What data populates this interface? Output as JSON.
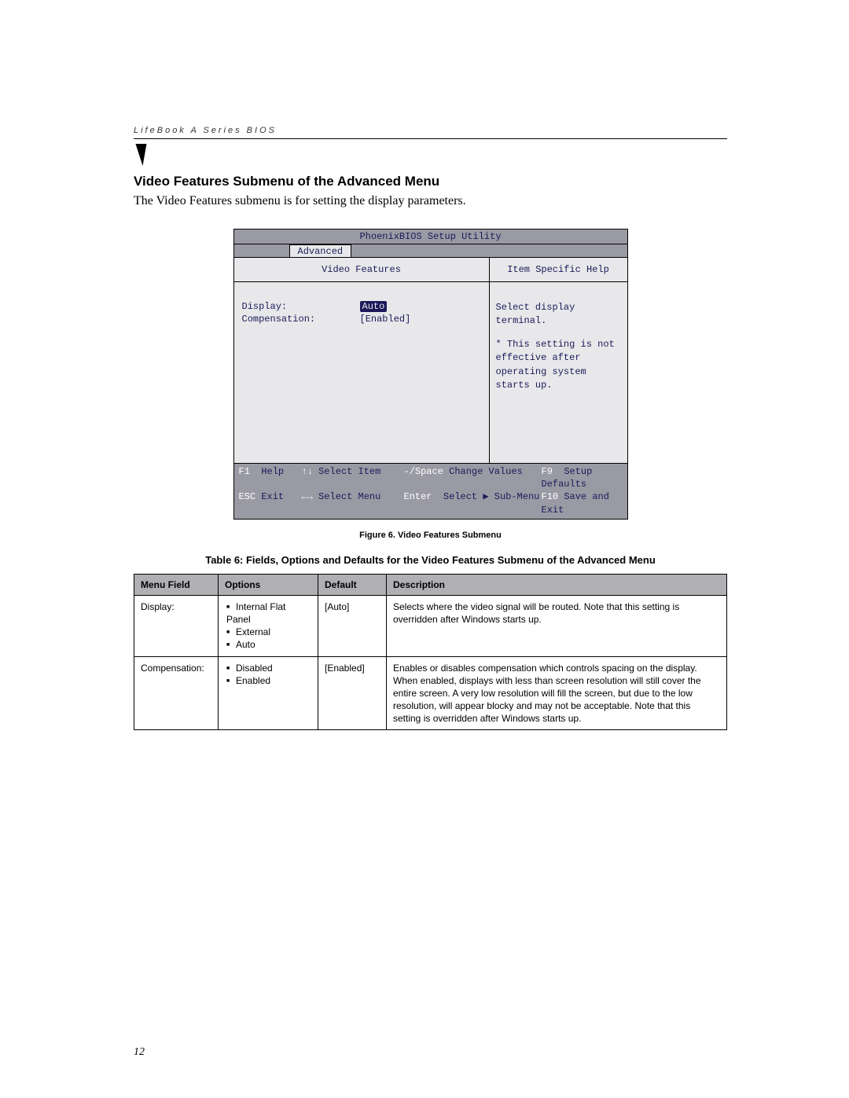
{
  "running_head": "LifeBook A Series BIOS",
  "section_heading": "Video Features Submenu of the Advanced Menu",
  "section_intro": "The Video Features submenu is for setting the display parameters.",
  "bios": {
    "title": "PhoenixBIOS Setup Utility",
    "active_tab": "Advanced",
    "left_heading": "Video Features",
    "right_heading": "Item Specific Help",
    "items": [
      {
        "label": "Display:",
        "value": "Auto",
        "selected": true
      },
      {
        "label": "Compensation:",
        "value": "[Enabled]",
        "selected": false
      }
    ],
    "help_line1": "Select display terminal.",
    "help_rest": "* This setting is not effective after operating system starts up.",
    "footer": {
      "r1": {
        "k1": "F1",
        "t1": "Help",
        "k2": "↑↓",
        "t2": "Select Item",
        "k3": "-/Space",
        "t3": "Change Values",
        "k4": "F9",
        "t4": "Setup Defaults"
      },
      "r2": {
        "k1": "ESC",
        "t1": "Exit",
        "k2": "←→",
        "t2": "Select Menu",
        "k3": "Enter",
        "t3": "Select ▶ Sub-Menu",
        "k4": "F10",
        "t4": "Save and Exit"
      }
    }
  },
  "figure_caption": "Figure 6.  Video Features Submenu",
  "table_caption": "Table 6: Fields, Options and Defaults for the Video Features Submenu of the Advanced Menu",
  "table": {
    "headers": {
      "menu_field": "Menu Field",
      "options": "Options",
      "default": "Default",
      "description": "Description"
    },
    "rows": [
      {
        "menu_field": "Display:",
        "options": [
          "Internal Flat Panel",
          "External",
          "Auto"
        ],
        "default": "[Auto]",
        "description": "Selects where the video signal will be routed. Note that this setting is overridden after Windows starts up."
      },
      {
        "menu_field": "Compensation:",
        "options": [
          "Disabled",
          "Enabled"
        ],
        "default": "[Enabled]",
        "description": "Enables or disables compensation which controls spacing on the display. When enabled, displays with less than screen resolution will still cover the entire screen. A very low resolution will fill the screen, but due to the low resolution, will appear blocky and may not be acceptable. Note that this setting is overridden after Windows starts up."
      }
    ]
  },
  "page_number": "12"
}
